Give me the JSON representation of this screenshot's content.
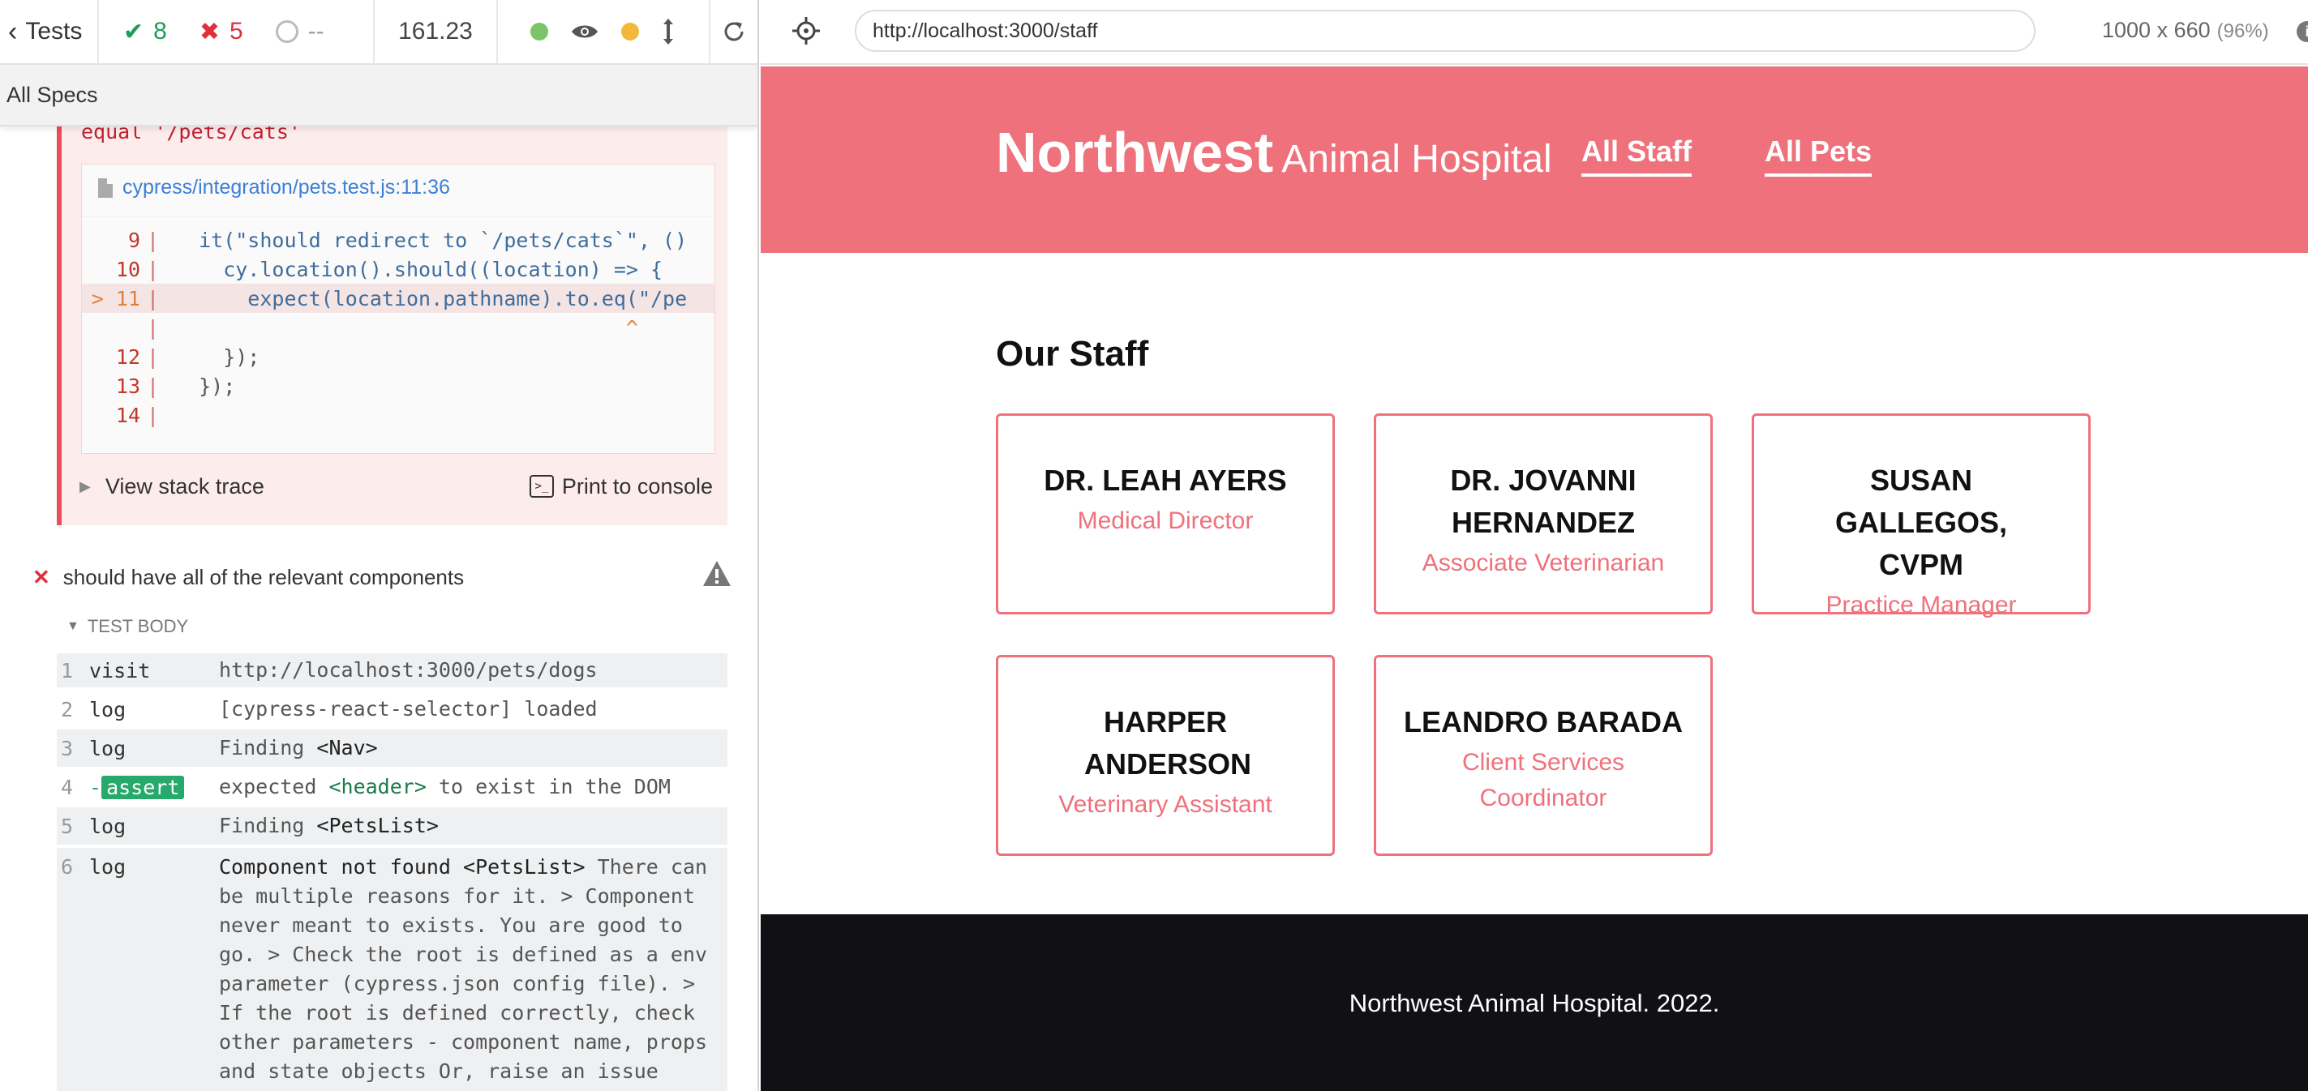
{
  "reporter": {
    "tests_label": "Tests",
    "passed": "8",
    "failed": "5",
    "pending": "--",
    "duration": "161.23",
    "specs_label": "All Specs"
  },
  "error": {
    "message": "equal '/pets/cats'",
    "file_link": "cypress/integration/pets.test.js:11:36",
    "code_lines": [
      {
        "num": "9",
        "text": "  it(\"should redirect to `/pets/cats`\", ()"
      },
      {
        "num": "10",
        "text": "    cy.location().should((location) => {"
      },
      {
        "num": "> 11",
        "text": "      expect(location.pathname).to.eq(\"/pe"
      },
      {
        "num": "",
        "text": "                                     ^"
      },
      {
        "num": "12",
        "text": "    });"
      },
      {
        "num": "13",
        "text": "  });"
      },
      {
        "num": "14",
        "text": ""
      }
    ],
    "stack_trace_label": "View stack trace",
    "print_label": "Print to console"
  },
  "test": {
    "title": "should have all of the relevant components",
    "body_label": "TEST BODY",
    "commands": [
      {
        "n": "1",
        "name": "visit",
        "msg": "http://localhost:3000/pets/dogs"
      },
      {
        "n": "2",
        "name": "log",
        "msg": "[cypress-react-selector] loaded"
      },
      {
        "n": "3",
        "name": "log",
        "msg_pre": "Finding ",
        "msg_strong": "<Nav>"
      },
      {
        "n": "4",
        "name": "-assert",
        "tag": "assert",
        "msg_a": "expected ",
        "msg_b": "<header>",
        "msg_c": " to exist in the DOM"
      },
      {
        "n": "5",
        "name": "log",
        "msg_pre": "Finding ",
        "msg_strong": "<PetsList>"
      },
      {
        "n": "6",
        "name": "log",
        "msg_strong": "Component not found <PetsList>",
        "msg_rest": " There can be multiple reasons for it. > Component never meant to exists. You are good to go. > Check the root is defined as a env parameter (cypress.json config file). > If the root is defined correctly, check other parameters - component name, props and state objects Or, raise an issue with proper code samples here:"
      }
    ]
  },
  "browser": {
    "url": "http://localhost:3000/staff",
    "viewport": "1000 x 660",
    "scale": "(96%)"
  },
  "site": {
    "logo_main": "Northwest",
    "logo_sub": "Animal Hospital",
    "nav": [
      "All Staff",
      "All Pets"
    ],
    "heading": "Our Staff",
    "staff": [
      {
        "name": "DR. LEAH AYERS",
        "role": "Medical Director"
      },
      {
        "name": "DR. JOVANNI HERNANDEZ",
        "role": "Associate Veterinarian"
      },
      {
        "name": "SUSAN GALLEGOS, CVPM",
        "role": "Practice Manager"
      },
      {
        "name": "HARPER ANDERSON",
        "role": "Veterinary Assistant"
      },
      {
        "name": "LEANDRO BARADA",
        "role": "Client Services Coordinator"
      }
    ],
    "footer": "Northwest Animal Hospital. 2022."
  },
  "colors": {
    "brand": "#ee717b",
    "pass": "#1f9c5a",
    "fail": "#e0303e",
    "footer_bg": "#111014"
  }
}
